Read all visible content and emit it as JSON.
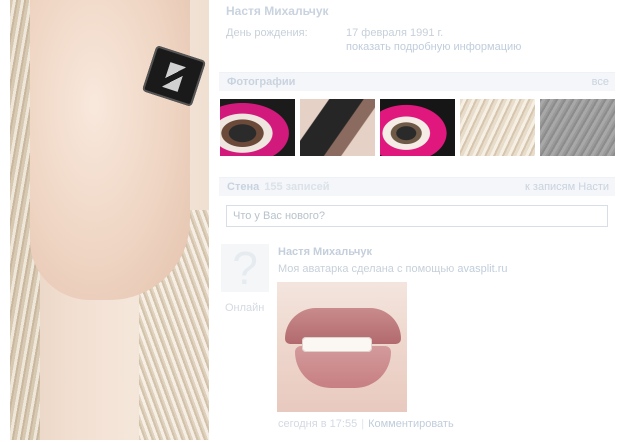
{
  "profile": {
    "name": "Настя Михальчук",
    "birthday_label": "День рождения:",
    "birthday_value": "17 февраля 1991 г.",
    "show_more": "показать подробную информацию"
  },
  "photos": {
    "title": "Фотографии",
    "all_link": "все",
    "items": [
      "photo-1",
      "photo-2",
      "photo-3",
      "photo-4",
      "photo-5"
    ]
  },
  "wall": {
    "title": "Стена",
    "count": "155 записей",
    "to_posts_link": "к записям Насти",
    "input_placeholder": "Что у Вас нового?",
    "post": {
      "author": "Настя Михальчук",
      "text": "Моя аватарка сделана с помощью",
      "link": "avasplit.ru",
      "status": "Онлайн",
      "timestamp": "сегодня в 17:55",
      "separator": "|",
      "comment_link": "Комментировать"
    }
  },
  "colors": {
    "header_text": "#c9d3df",
    "section_bg": "#f4f6f9",
    "link": "#c0cddc"
  },
  "icons": {
    "wall_avatar": "question-mark-icon"
  }
}
